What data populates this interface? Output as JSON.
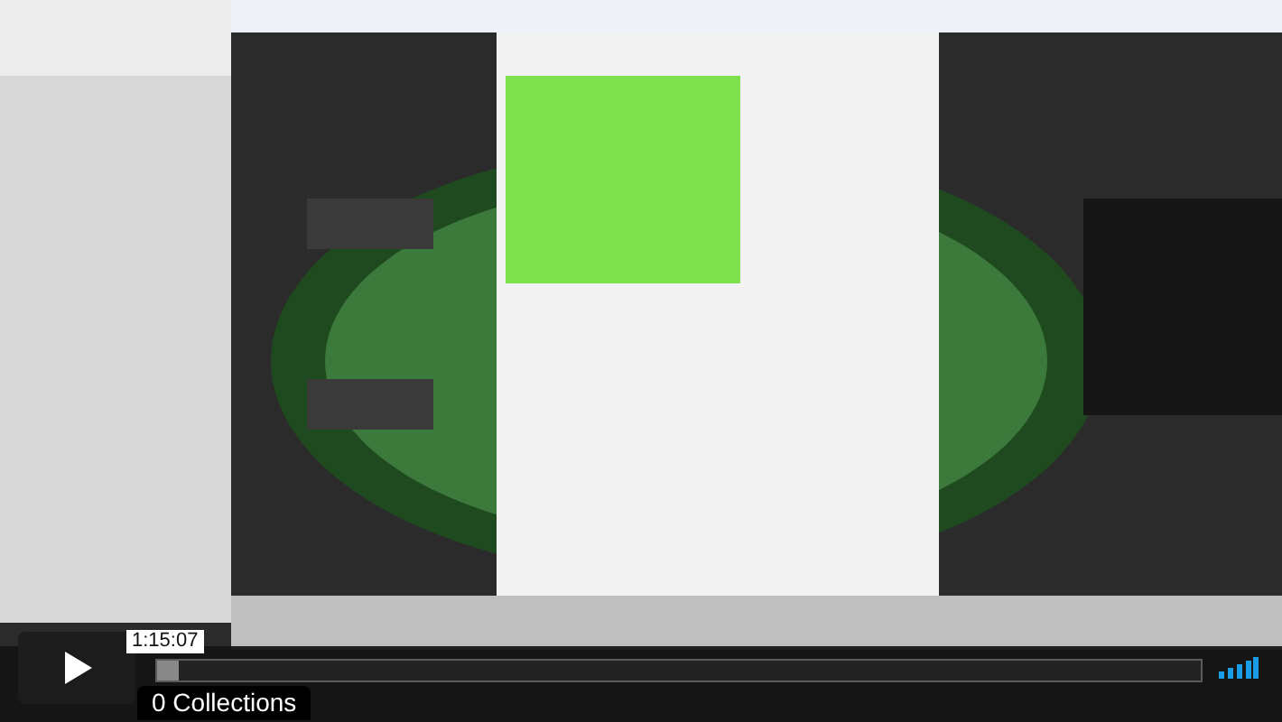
{
  "player": {
    "playing": false,
    "time_tooltip": "1:15:07",
    "progress": {
      "level": 0.02
    },
    "collections": "0 Collections"
  }
}
